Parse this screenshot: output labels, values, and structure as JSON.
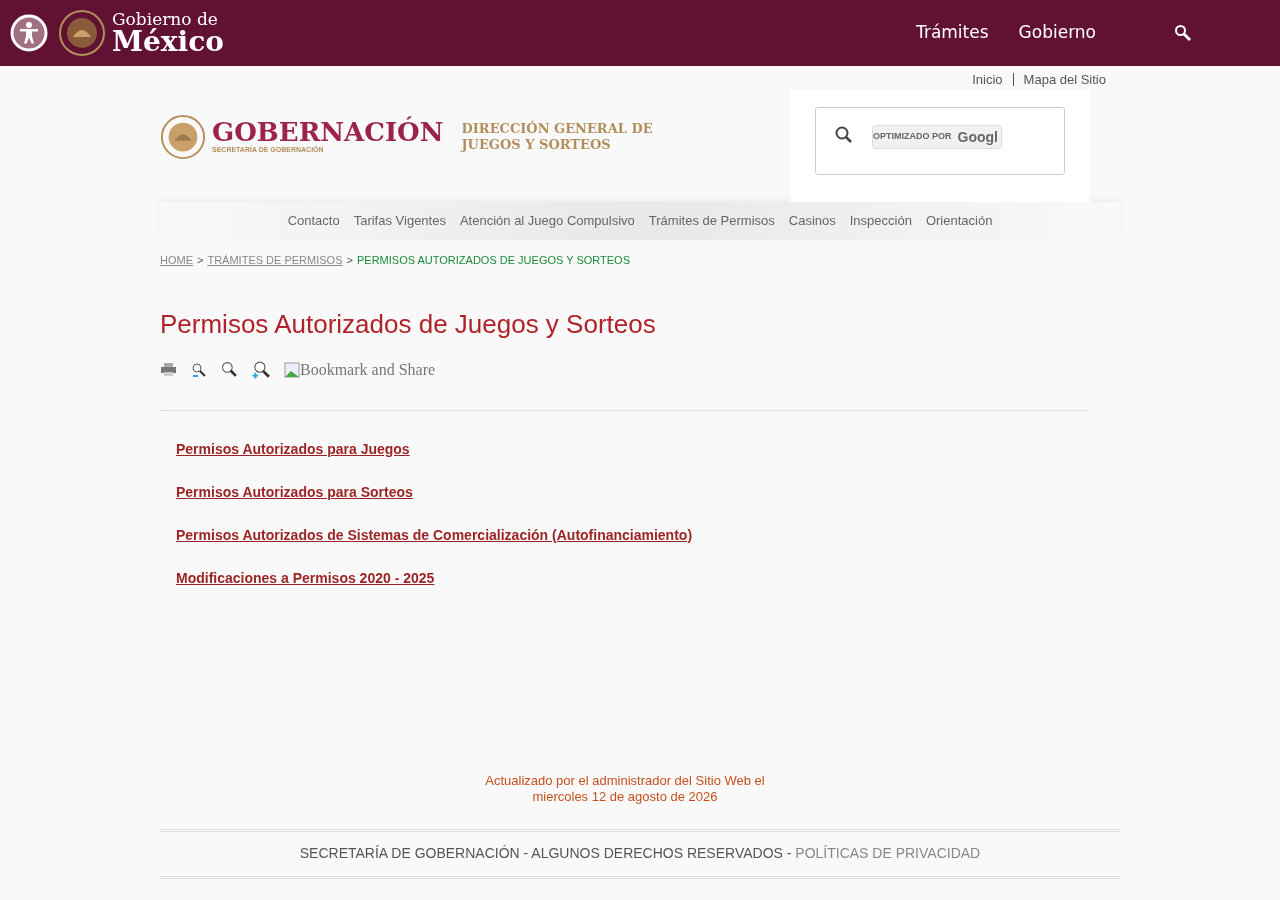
{
  "header": {
    "brand_top": "Gobierno de",
    "brand_bottom": "México",
    "nav": [
      "Trámites",
      "Gobierno"
    ]
  },
  "top_links": [
    "Inicio",
    "Mapa del Sitio"
  ],
  "logo": {
    "title": "GOBERNACIÓN",
    "subtitle": "SECRETARÍA DE GOBERNACIÓN",
    "unit_line1": "DIRECCIÓN GENERAL DE",
    "unit_line2": "JUEGOS Y SORTEOS"
  },
  "search": {
    "badge_prefix": "OPTIMIZADO POR",
    "badge_brand": "Googl"
  },
  "menu": [
    "Contacto",
    "Tarifas Vigentes",
    "Atención al Juego Compulsivo",
    "Trámites de Permisos",
    "Casinos",
    "Inspección",
    "Orientación"
  ],
  "breadcrumb": [
    {
      "label": "HOME",
      "current": false
    },
    {
      "separator": ">",
      "label": "TRÁMITES DE PERMISOS",
      "current": false
    },
    {
      "separator": ">",
      "label": "PERMISOS AUTORIZADOS DE JUEGOS Y SORTEOS",
      "current": true
    }
  ],
  "page_title": "Permisos Autorizados de Juegos y Sorteos",
  "bookmark_alt": "Bookmark and Share",
  "links": [
    "Permisos Autorizados para Juegos",
    "Permisos Autorizados para Sorteos",
    "Permisos Autorizados de Sistemas de Comercialización (Autofinanciamiento)",
    "Modificaciones a Permisos 2020 - 2025"
  ],
  "updated": [
    "Actualizado por el administrador del Sitio Web el",
    "miercoles 12 de agosto de 2026"
  ],
  "footer": {
    "text": "SECRETARÍA DE GOBERNACIÓN - ALGUNOS DERECHOS RESERVADOS - ",
    "link": "POLÍTICAS DE PRIVACIDAD"
  }
}
